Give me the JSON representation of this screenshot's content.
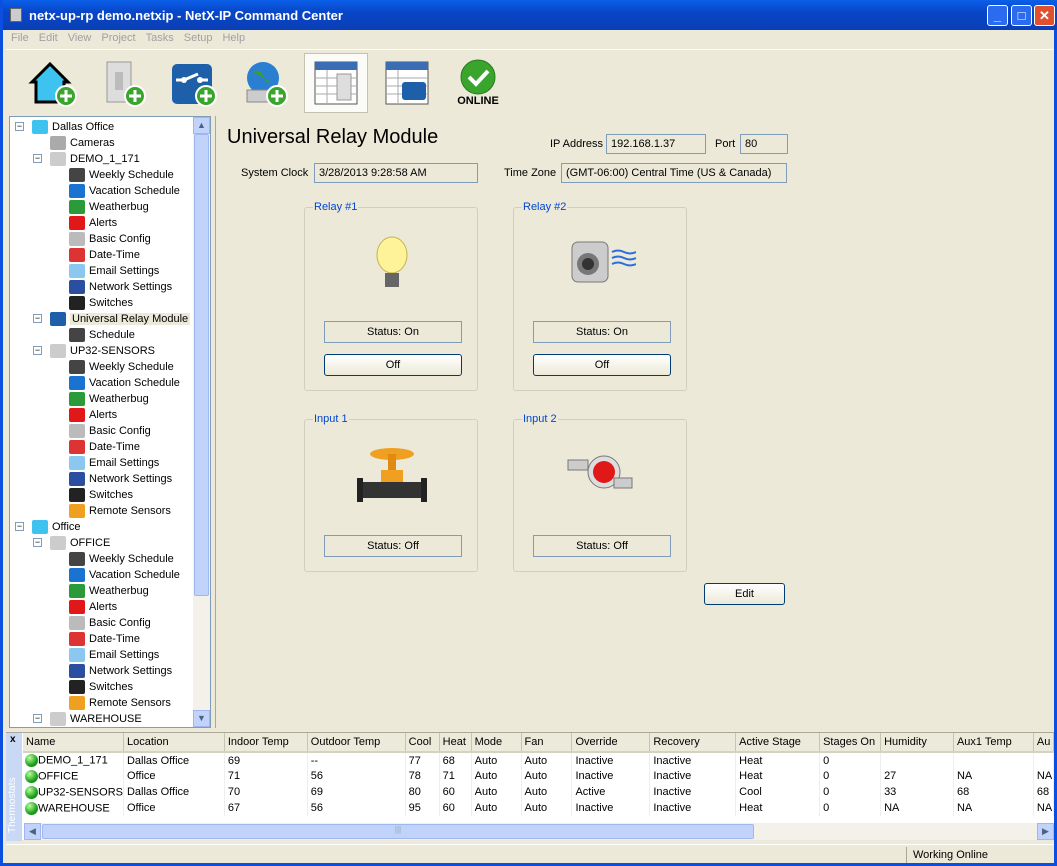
{
  "window": {
    "title": "netx-up-rp demo.netxip - NetX-IP Command Center",
    "min": "_",
    "max": "□",
    "close": "✕"
  },
  "menu": [
    "File",
    "Edit",
    "View",
    "Project",
    "Tasks",
    "Setup",
    "Help"
  ],
  "toolbar": {
    "buttons": [
      {
        "name": "add-site",
        "icon": "house-plus-icon"
      },
      {
        "name": "add-thermostat",
        "icon": "thermostat-plus-icon"
      },
      {
        "name": "add-relay",
        "icon": "relay-plus-icon"
      },
      {
        "name": "add-network",
        "icon": "globe-plus-icon"
      },
      {
        "name": "thermostat-view",
        "icon": "thermostat-grid-icon",
        "selected": true
      },
      {
        "name": "relay-view",
        "icon": "relay-grid-icon"
      },
      {
        "name": "online",
        "icon": "check-icon",
        "label": "ONLINE"
      }
    ]
  },
  "tree": [
    {
      "l": 0,
      "t": "Dallas Office",
      "ic": "house",
      "exp": true
    },
    {
      "l": 1,
      "t": "Cameras",
      "ic": "camera"
    },
    {
      "l": 1,
      "t": "DEMO_1_171",
      "ic": "thermostat",
      "exp": true
    },
    {
      "l": 2,
      "t": "Weekly Schedule",
      "ic": "clock"
    },
    {
      "l": 2,
      "t": "Vacation Schedule",
      "ic": "suitcase"
    },
    {
      "l": 2,
      "t": "Weatherbug",
      "ic": "weatherbug"
    },
    {
      "l": 2,
      "t": "Alerts",
      "ic": "alarm"
    },
    {
      "l": 2,
      "t": "Basic Config",
      "ic": "gear"
    },
    {
      "l": 2,
      "t": "Date-Time",
      "ic": "calendar"
    },
    {
      "l": 2,
      "t": "Email Settings",
      "ic": "envelope"
    },
    {
      "l": 2,
      "t": "Network Settings",
      "ic": "router"
    },
    {
      "l": 2,
      "t": "Switches",
      "ic": "switches"
    },
    {
      "l": 1,
      "t": "Universal Relay Module",
      "ic": "relay",
      "exp": true,
      "sel": true
    },
    {
      "l": 2,
      "t": "Schedule",
      "ic": "clock"
    },
    {
      "l": 1,
      "t": "UP32-SENSORS",
      "ic": "thermostat",
      "exp": true
    },
    {
      "l": 2,
      "t": "Weekly Schedule",
      "ic": "clock"
    },
    {
      "l": 2,
      "t": "Vacation Schedule",
      "ic": "suitcase"
    },
    {
      "l": 2,
      "t": "Weatherbug",
      "ic": "weatherbug"
    },
    {
      "l": 2,
      "t": "Alerts",
      "ic": "alarm"
    },
    {
      "l": 2,
      "t": "Basic Config",
      "ic": "gear"
    },
    {
      "l": 2,
      "t": "Date-Time",
      "ic": "calendar"
    },
    {
      "l": 2,
      "t": "Email Settings",
      "ic": "envelope"
    },
    {
      "l": 2,
      "t": "Network Settings",
      "ic": "router"
    },
    {
      "l": 2,
      "t": "Switches",
      "ic": "switches"
    },
    {
      "l": 2,
      "t": "Remote Sensors",
      "ic": "sensor"
    },
    {
      "l": 0,
      "t": "Office",
      "ic": "house",
      "exp": true
    },
    {
      "l": 1,
      "t": "OFFICE",
      "ic": "thermostat",
      "exp": true
    },
    {
      "l": 2,
      "t": "Weekly Schedule",
      "ic": "clock"
    },
    {
      "l": 2,
      "t": "Vacation Schedule",
      "ic": "suitcase"
    },
    {
      "l": 2,
      "t": "Weatherbug",
      "ic": "weatherbug"
    },
    {
      "l": 2,
      "t": "Alerts",
      "ic": "alarm"
    },
    {
      "l": 2,
      "t": "Basic Config",
      "ic": "gear"
    },
    {
      "l": 2,
      "t": "Date-Time",
      "ic": "calendar"
    },
    {
      "l": 2,
      "t": "Email Settings",
      "ic": "envelope"
    },
    {
      "l": 2,
      "t": "Network Settings",
      "ic": "router"
    },
    {
      "l": 2,
      "t": "Switches",
      "ic": "switches"
    },
    {
      "l": 2,
      "t": "Remote Sensors",
      "ic": "sensor"
    },
    {
      "l": 1,
      "t": "WAREHOUSE",
      "ic": "thermostat",
      "exp": true
    }
  ],
  "main": {
    "title": "Universal Relay Module",
    "ip_label": "IP Address",
    "ip": "192.168.1.37",
    "port_label": "Port",
    "port": "80",
    "clock_label": "System Clock",
    "clock": "3/28/2013  9:28:58 AM",
    "tz_label": "Time Zone",
    "tz": "(GMT-06:00) Central Time (US & Canada)",
    "relay1": {
      "title": "Relay #1",
      "status": "Status: On",
      "button": "Off"
    },
    "relay2": {
      "title": "Relay #2",
      "status": "Status: On",
      "button": "Off"
    },
    "input1": {
      "title": "Input 1",
      "status": "Status: Off"
    },
    "input2": {
      "title": "Input 2",
      "status": "Status: Off"
    },
    "edit": "Edit"
  },
  "grid": {
    "panel_label": "Thermostats",
    "close": "x",
    "columns": [
      "Name",
      "Location",
      "Indoor Temp",
      "Outdoor Temp",
      "Cool",
      "Heat",
      "Mode",
      "Fan",
      "Override",
      "Recovery",
      "Active Stage",
      "Stages On",
      "Humidity",
      "Aux1 Temp",
      "Au"
    ],
    "sort_indicator": "/",
    "rows": [
      [
        "DEMO_1_171",
        "Dallas Office",
        "69",
        "--",
        "77",
        "68",
        "Auto",
        "Auto",
        "Inactive",
        "Inactive",
        "Heat",
        "0",
        "",
        "",
        ""
      ],
      [
        "OFFICE",
        "Office",
        "71",
        "56",
        "78",
        "71",
        "Auto",
        "Auto",
        "Inactive",
        "Inactive",
        "Heat",
        "0",
        "27",
        "NA",
        "NA"
      ],
      [
        "UP32-SENSORS",
        "Dallas Office",
        "70",
        "69",
        "80",
        "60",
        "Auto",
        "Auto",
        "Active",
        "Inactive",
        "Cool",
        "0",
        "33",
        "68",
        "68"
      ],
      [
        "WAREHOUSE",
        "Office",
        "67",
        "56",
        "95",
        "60",
        "Auto",
        "Auto",
        "Inactive",
        "Inactive",
        "Heat",
        "0",
        "NA",
        "NA",
        "NA"
      ]
    ]
  },
  "statusbar": {
    "text": "Working Online"
  }
}
